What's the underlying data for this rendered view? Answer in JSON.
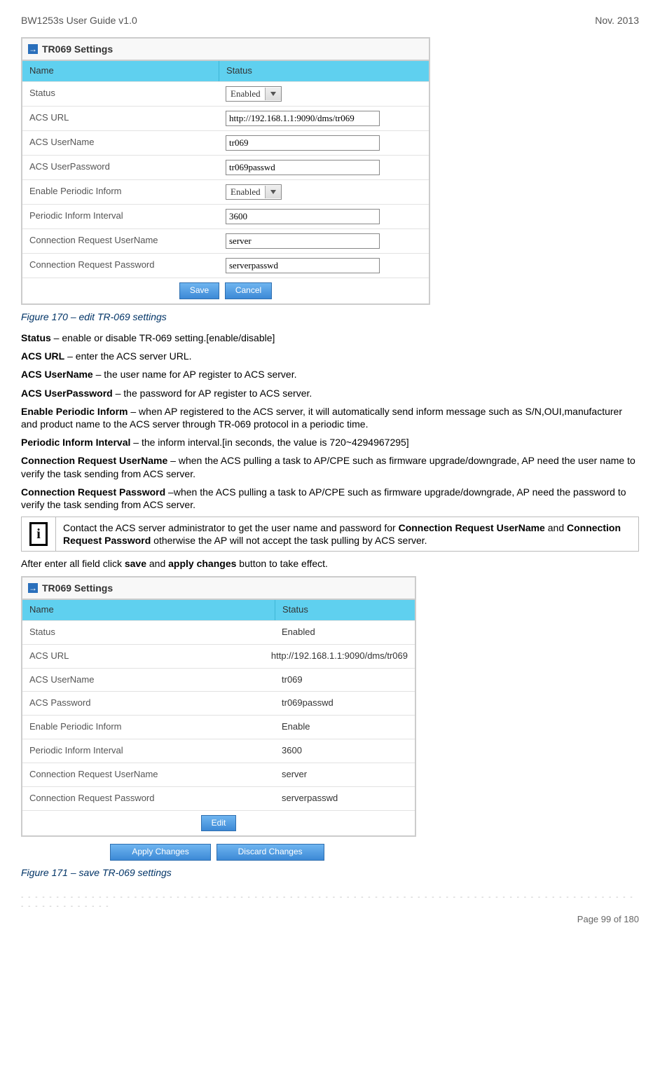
{
  "header": {
    "doc_title": "BW1253s User Guide v1.0",
    "date": "Nov.  2013"
  },
  "panel1": {
    "title": "TR069 Settings",
    "col_name": "Name",
    "col_status": "Status",
    "rows": {
      "status_label": "Status",
      "status_value": "Enabled",
      "acs_url_label": "ACS URL",
      "acs_url_value": "http://192.168.1.1:9090/dms/tr069",
      "acs_user_label": "ACS UserName",
      "acs_user_value": "tr069",
      "acs_pass_label": "ACS UserPassword",
      "acs_pass_value": "tr069passwd",
      "periodic_label": "Enable Periodic Inform",
      "periodic_value": "Enabled",
      "interval_label": "Periodic Inform Interval",
      "interval_value": "3600",
      "creq_user_label": "Connection Request UserName",
      "creq_user_value": "server",
      "creq_pass_label": "Connection Request Password",
      "creq_pass_value": "serverpasswd"
    },
    "save": "Save",
    "cancel": "Cancel"
  },
  "caption1": "Figure 170 – edit TR-069 settings",
  "descriptions": {
    "status": "Status – enable or disable TR-069 setting.[enable/disable]",
    "acs_url": "ACS URL – enter the ACS server URL.",
    "acs_user": "ACS UserName – the user name for AP register to ACS server.",
    "acs_pass": "ACS UserPassword – the password for AP register to ACS server.",
    "periodic": "Enable Periodic Inform – when AP registered to the ACS server, it will automatically send inform message such as S/N,OUI,manufacturer and product name to the ACS server through TR-069 protocol in a periodic time.",
    "interval": "Periodic Inform Interval – the inform interval.[in seconds, the value is 720~4294967295]",
    "creq_user": "Connection Request UserName – when the ACS pulling a task to AP/CPE such as firmware upgrade/downgrade, AP need the user name to verify the task sending from ACS server.",
    "creq_pass": "Connection Request Password –when the ACS pulling a task to AP/CPE such as firmware upgrade/downgrade, AP need the password to verify the task sending from ACS server."
  },
  "info_note": {
    "pre": "Contact the ACS server administrator to get the user name and password for ",
    "b1": "Connection Request UserName",
    "mid": " and ",
    "b2": "Connection Request Password",
    "post": " otherwise the AP will not accept the task pulling by ACS server."
  },
  "after_save_line_pre": "After enter all field click ",
  "after_save_b1": "save",
  "after_save_mid": " and ",
  "after_save_b2": "apply changes",
  "after_save_post": " button to take effect.",
  "panel2": {
    "title": "TR069 Settings",
    "col_name": "Name",
    "col_status": "Status",
    "rows": {
      "status_label": "Status",
      "status_value": "Enabled",
      "acs_url_label": "ACS URL",
      "acs_url_value": "http://192.168.1.1:9090/dms/tr069",
      "acs_user_label": "ACS UserName",
      "acs_user_value": "tr069",
      "acs_pass_label": "ACS Password",
      "acs_pass_value": "tr069passwd",
      "periodic_label": "Enable Periodic Inform",
      "periodic_value": "Enable",
      "interval_label": "Periodic Inform Interval",
      "interval_value": "3600",
      "creq_user_label": "Connection Request UserName",
      "creq_user_value": "server",
      "creq_pass_label": "Connection Request Password",
      "creq_pass_value": "serverpasswd"
    },
    "edit": "Edit",
    "apply": "Apply Changes",
    "discard": "Discard Changes"
  },
  "caption2": "Figure 171 – save TR-069 settings",
  "footer": "Page 99 of 180"
}
